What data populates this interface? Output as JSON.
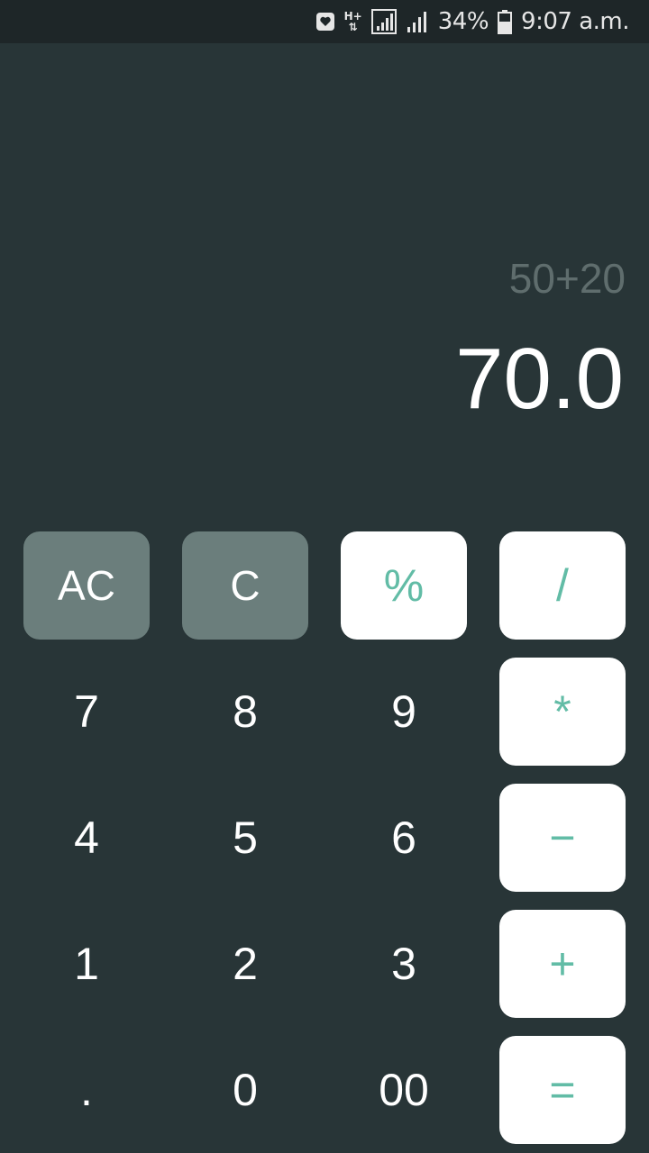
{
  "status_bar": {
    "network_type": "H+",
    "battery_percent": "34%",
    "time": "9:07 a.m."
  },
  "display": {
    "expression": "50+20",
    "result": "70.0"
  },
  "keys": {
    "ac": "AC",
    "c": "C",
    "percent": "%",
    "divide": "/",
    "seven": "7",
    "eight": "8",
    "nine": "9",
    "multiply": "*",
    "four": "4",
    "five": "5",
    "six": "6",
    "minus": "−",
    "one": "1",
    "two": "2",
    "three": "3",
    "plus": "+",
    "dot": ".",
    "zero": "0",
    "double_zero": "00",
    "equals": "="
  },
  "colors": {
    "background": "#283537",
    "status_bar": "#1e2628",
    "function_key": "#6b7e7c",
    "operator_key": "#ffffff",
    "accent": "#62bca6",
    "expression_text": "#5f6d6d"
  }
}
